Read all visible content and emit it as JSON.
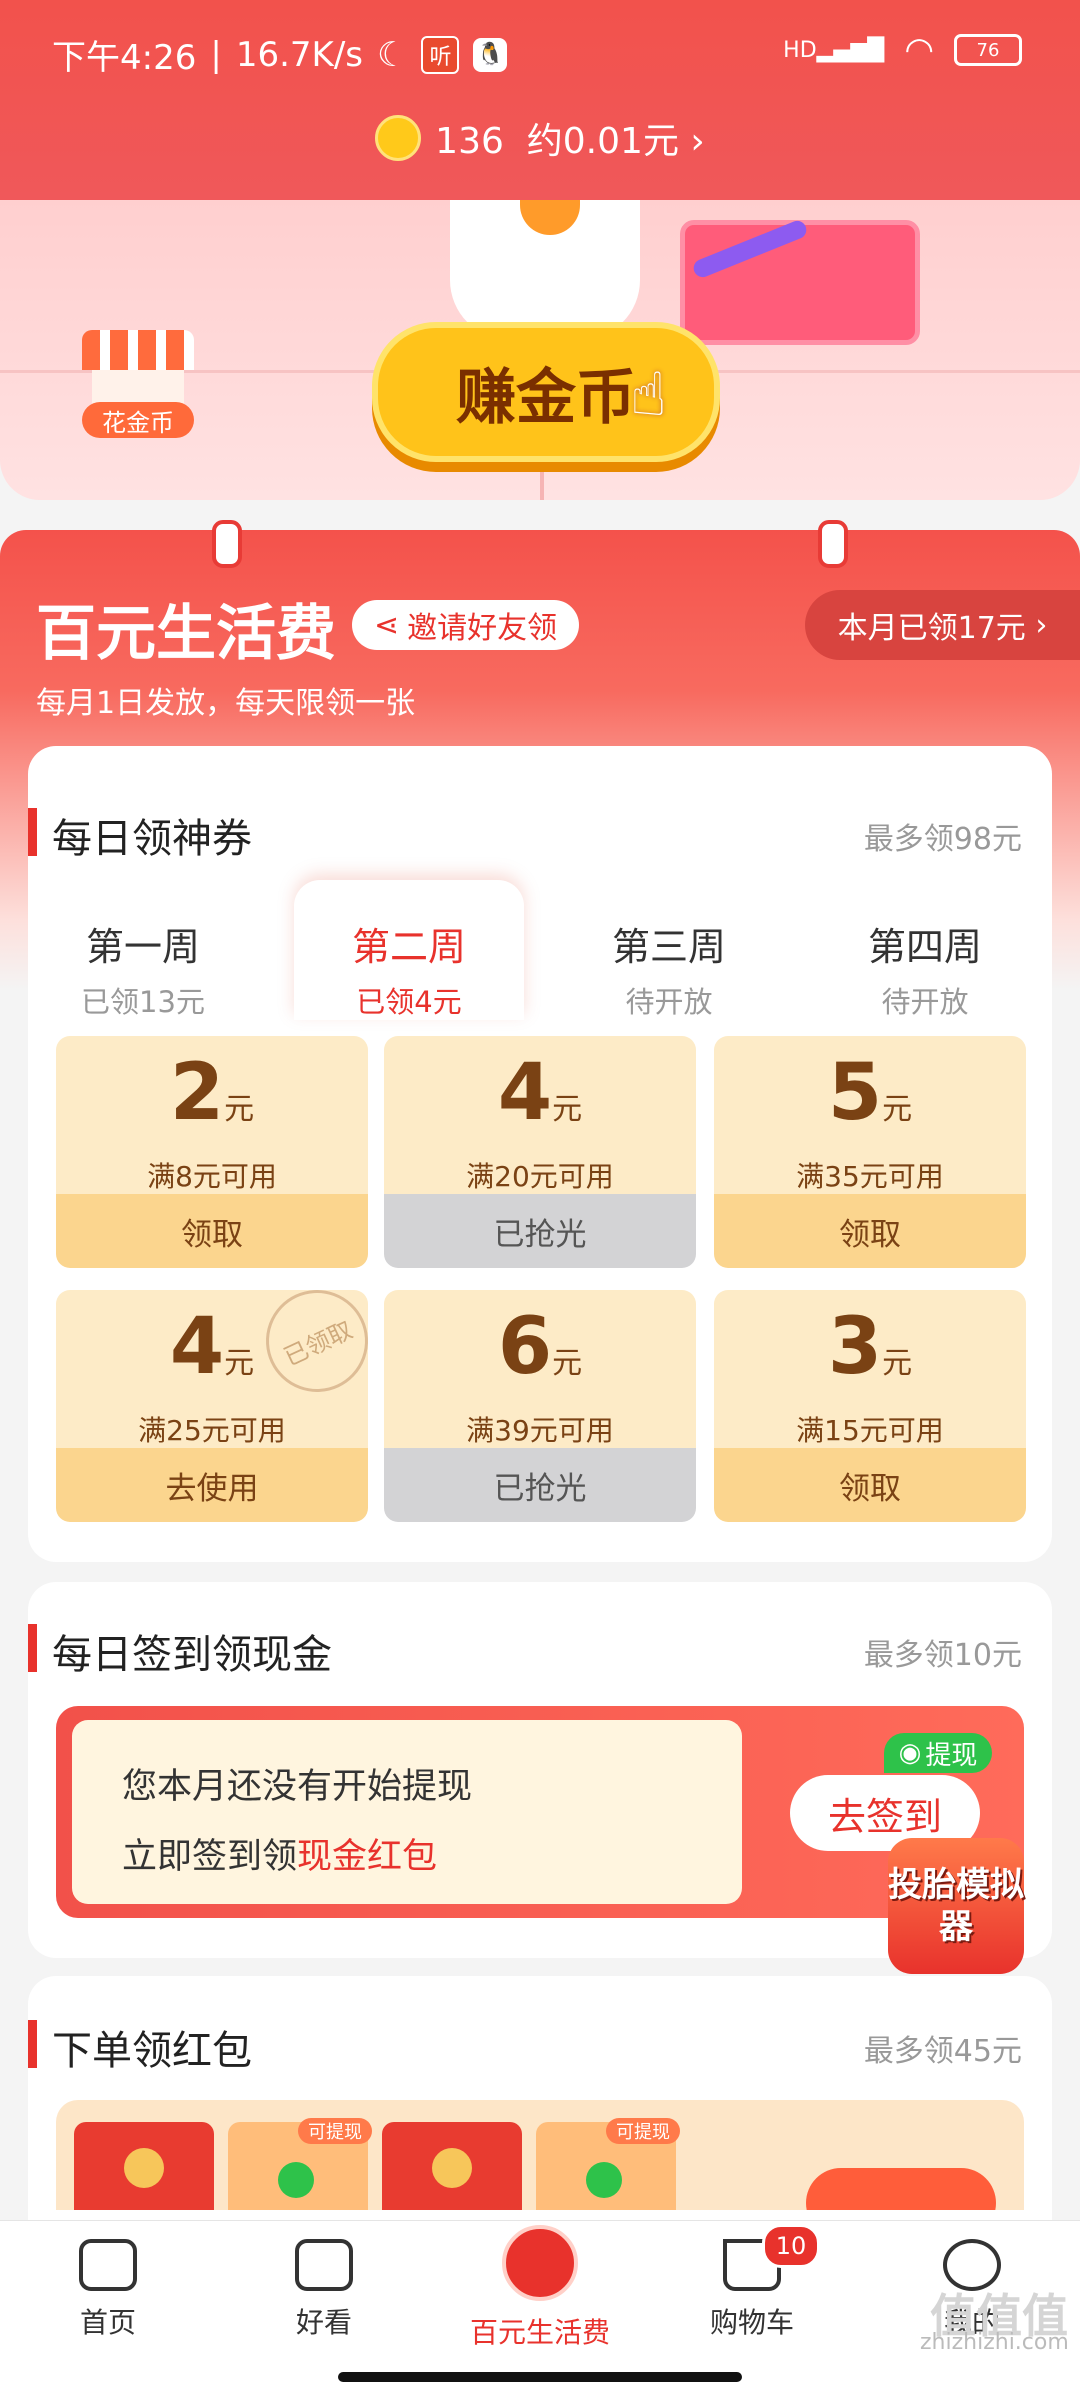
{
  "status_bar": {
    "time": "下午4:26",
    "net_speed": "16.7K/s",
    "listen_badge": "听",
    "signal": "HD",
    "battery": "76"
  },
  "coins": {
    "count": "136",
    "value": "约0.01元"
  },
  "banner": {
    "earn_label": "赚金币",
    "spend_label": "花金币"
  },
  "living_fund": {
    "title": "百元生活费",
    "invite_label": "邀请好友领",
    "month_received": "本月已领17元",
    "subtitle": "每月1日发放，每天限领一张"
  },
  "daily_coupon": {
    "title": "每日领神券",
    "max": "最多领98元",
    "weeks": [
      {
        "name": "第一周",
        "status": "已领13元"
      },
      {
        "name": "第二周",
        "status": "已领4元"
      },
      {
        "name": "第三周",
        "status": "待开放"
      },
      {
        "name": "第四周",
        "status": "待开放"
      }
    ],
    "coupons": [
      {
        "amount": "2",
        "unit": "元",
        "cond": "满8元可用",
        "btn": "领取"
      },
      {
        "amount": "4",
        "unit": "元",
        "cond": "满20元可用",
        "btn": "已抢光"
      },
      {
        "amount": "5",
        "unit": "元",
        "cond": "满35元可用",
        "btn": "领取"
      },
      {
        "amount": "4",
        "unit": "元",
        "cond": "满25元可用",
        "btn": "去使用",
        "stamp": "已领取"
      },
      {
        "amount": "6",
        "unit": "元",
        "cond": "满39元可用",
        "btn": "已抢光"
      },
      {
        "amount": "3",
        "unit": "元",
        "cond": "满15元可用",
        "btn": "领取"
      }
    ]
  },
  "daily_sign": {
    "title": "每日签到领现金",
    "max": "最多领10元",
    "line1": "您本月还没有开始提现",
    "line2_prefix": "立即签到领",
    "line2_highlight": "现金红包",
    "button": "去签到",
    "wx_tag": "提现",
    "float_game": "投胎模拟器"
  },
  "order_redpack": {
    "title": "下单领红包",
    "max": "最多领45元",
    "tag": "可提现"
  },
  "nav": {
    "items": [
      "首页",
      "好看",
      "百元生活费",
      "购物车",
      "我的"
    ],
    "cart_badge": "10"
  },
  "watermark": "zhizhizhi.com",
  "colors": {
    "accent": "#e8322c",
    "coupon_bg": "#fdebc7",
    "coupon_btn": "#fbd58e"
  }
}
